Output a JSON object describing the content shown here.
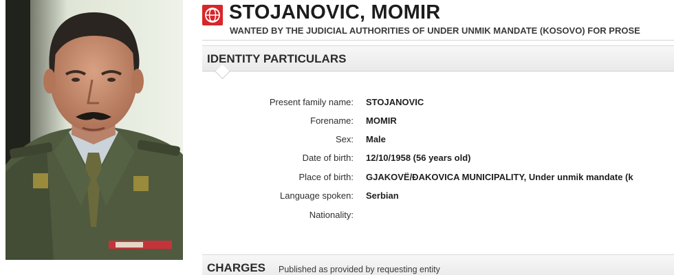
{
  "person": {
    "name": "STOJANOVIC, MOMIR",
    "subtitle": "WANTED BY THE JUDICIAL AUTHORITIES OF UNDER UNMIK MANDATE (KOSOVO) FOR PROSE"
  },
  "sections": {
    "identity_title": "IDENTITY PARTICULARS",
    "charges_title": "CHARGES",
    "charges_note": "Published as provided by requesting entity"
  },
  "identity": {
    "family_name": {
      "label": "Present family name:",
      "value": "STOJANOVIC"
    },
    "forename": {
      "label": "Forename:",
      "value": "MOMIR"
    },
    "sex": {
      "label": "Sex:",
      "value": "Male"
    },
    "dob": {
      "label": "Date of birth:",
      "value": "12/10/1958 (56 years old)"
    },
    "pob": {
      "label": "Place of birth:",
      "value": "GJAKOVË/ĐAKOVICA MUNICIPALITY, Under unmik mandate (k"
    },
    "language": {
      "label": "Language spoken:",
      "value": "Serbian"
    },
    "nationality": {
      "label": "Nationality:",
      "value": ""
    }
  },
  "icons": {
    "logo": "interpol-globe-logo"
  },
  "colors": {
    "logo_red": "#d8262a",
    "uniform_green": "#4f5a3f"
  }
}
